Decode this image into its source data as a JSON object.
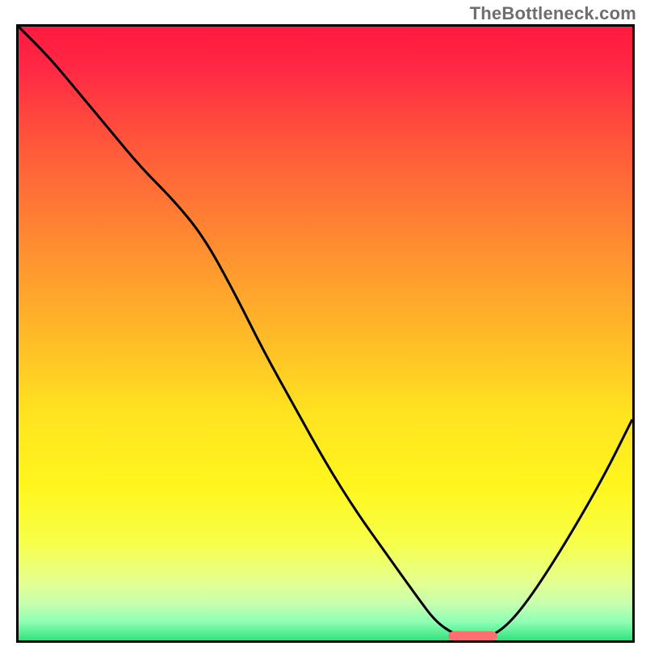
{
  "watermark": "TheBottleneck.com",
  "chart_data": {
    "type": "line",
    "title": "",
    "xlabel": "",
    "ylabel": "",
    "xlim": [
      0,
      100
    ],
    "ylim": [
      0,
      100
    ],
    "grid": false,
    "legend": false,
    "background": {
      "kind": "vertical-gradient",
      "stops": [
        {
          "pos": 0.0,
          "color": "#ff1a3f"
        },
        {
          "pos": 0.07,
          "color": "#ff2944"
        },
        {
          "pos": 0.2,
          "color": "#ff5a3a"
        },
        {
          "pos": 0.35,
          "color": "#ff8b31"
        },
        {
          "pos": 0.5,
          "color": "#ffb928"
        },
        {
          "pos": 0.63,
          "color": "#ffe320"
        },
        {
          "pos": 0.75,
          "color": "#fff61e"
        },
        {
          "pos": 0.84,
          "color": "#f7ff48"
        },
        {
          "pos": 0.9,
          "color": "#e7ff8a"
        },
        {
          "pos": 0.94,
          "color": "#c7ffb0"
        },
        {
          "pos": 0.97,
          "color": "#8effb3"
        },
        {
          "pos": 1.0,
          "color": "#32e27d"
        }
      ]
    },
    "series": [
      {
        "name": "bottleneck-curve",
        "color": "#000000",
        "x": [
          0,
          5,
          10,
          15,
          20,
          25,
          30,
          35,
          40,
          45,
          50,
          55,
          60,
          65,
          68,
          71,
          73,
          75,
          78,
          82,
          88,
          95,
          100
        ],
        "y": [
          100,
          95,
          89,
          83,
          77,
          72,
          66,
          57,
          47,
          38,
          29,
          21,
          14,
          7,
          3,
          1,
          0.5,
          0.5,
          1,
          5,
          14,
          26,
          36
        ]
      }
    ],
    "marker": {
      "name": "optimal-zone-marker",
      "x_range": [
        70,
        78
      ],
      "y": 0.7,
      "color": "#ff6f6f",
      "thickness": 1.6
    }
  }
}
